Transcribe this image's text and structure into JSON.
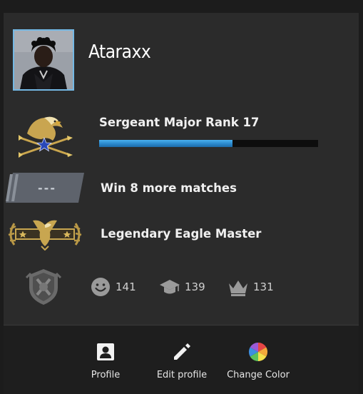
{
  "profile": {
    "username": "Ataraxx"
  },
  "rank": {
    "title": "Sergeant Major Rank 17",
    "xp_progress": 0.61
  },
  "wins": {
    "text": "Win 8 more matches",
    "badge_text": "---"
  },
  "skill_group": {
    "text": "Legendary Eagle Master"
  },
  "commendations": [
    {
      "icon": "smile-icon",
      "label": "friendly",
      "count": "141"
    },
    {
      "icon": "teacher-icon",
      "label": "teacher",
      "count": "139"
    },
    {
      "icon": "leader-icon",
      "label": "leader",
      "count": "131"
    }
  ],
  "footer": {
    "profile_label": "Profile",
    "edit_label": "Edit profile",
    "color_label": "Change Color"
  },
  "colors": {
    "accent": "#74b8e4",
    "xp_fill": "#3a9ee0",
    "panel": "#2b2b2b",
    "footer": "#1e1e1e"
  }
}
